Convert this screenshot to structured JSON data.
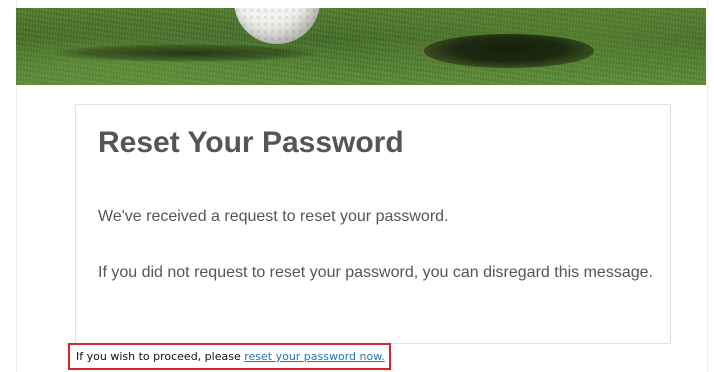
{
  "banner": {
    "image": "golf-ball-near-hole-banner"
  },
  "email": {
    "title": "Reset Your Password",
    "paragraphs": [
      "We've received a request to reset your password.",
      "If you did not request to reset your password, you can disregard this message."
    ],
    "proceed": {
      "prefix": "If you wish to proceed, please ",
      "link_text": "reset your password now."
    }
  },
  "colors": {
    "text": "#555555",
    "link": "#1f73b7",
    "highlight_border": "#d7262a",
    "card_border": "#e3e3e3"
  }
}
